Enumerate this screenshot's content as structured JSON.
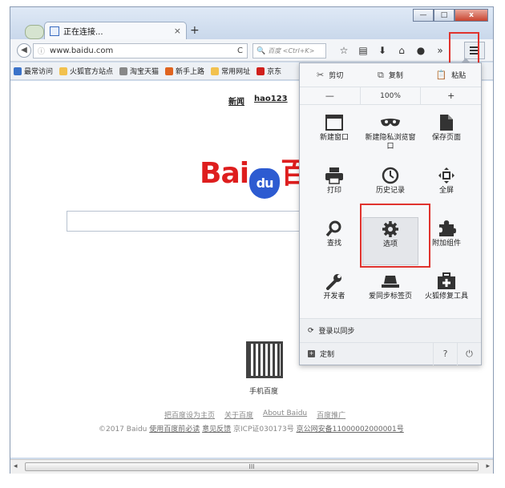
{
  "tab": {
    "title": "正在连接...",
    "close": "×",
    "new_tab": "+"
  },
  "window": {
    "minimize": "—",
    "maximize": "□",
    "close": "x"
  },
  "navbar": {
    "url": "www.baidu.com",
    "search_placeholder": "百度 <Ctrl+K>",
    "icons": [
      "star-icon",
      "library-icon",
      "download-icon",
      "home-icon",
      "chat-icon",
      "overflow-icon"
    ]
  },
  "bookmarks": [
    {
      "label": "最常访问",
      "color": "#3b73c9"
    },
    {
      "label": "火狐官方站点",
      "color": "#f2c14e"
    },
    {
      "label": "淘宝天猫",
      "color": "#888888"
    },
    {
      "label": "新手上路",
      "color": "#e0641f"
    },
    {
      "label": "常用网址",
      "color": "#f2c14e"
    },
    {
      "label": "京东",
      "color": "#d0201c"
    }
  ],
  "content": {
    "top_links": [
      "新闻",
      "hao123"
    ],
    "logo_left": "Bai",
    "logo_paw": "du",
    "logo_right": "百",
    "qr_label": "手机百度",
    "footer_links": [
      "把百度设为主页",
      "关于百度",
      "About Baidu",
      "百度推广"
    ],
    "footer_copy_prefix": "©2017 Baidu ",
    "footer_copy_links": [
      "使用百度前必读",
      "意见反馈"
    ],
    "footer_icp": " 京ICP证030173号 ",
    "footer_police": "京公网安备11000002000001号"
  },
  "menu": {
    "edit": {
      "cut": "剪切",
      "copy": "复制",
      "paste": "粘贴"
    },
    "zoom": {
      "minus": "—",
      "value": "100%",
      "plus": "+"
    },
    "items": [
      {
        "label": "新建窗口",
        "icon": "window-icon"
      },
      {
        "label": "新建隐私浏览窗口",
        "icon": "mask-icon"
      },
      {
        "label": "保存页面",
        "icon": "page-icon"
      },
      {
        "label": "打印",
        "icon": "printer-icon"
      },
      {
        "label": "历史记录",
        "icon": "clock-icon"
      },
      {
        "label": "全屏",
        "icon": "fullscreen-icon"
      },
      {
        "label": "查找",
        "icon": "search-icon"
      },
      {
        "label": "选项",
        "icon": "gear-icon"
      },
      {
        "label": "附加组件",
        "icon": "puzzle-icon"
      },
      {
        "label": "开发者",
        "icon": "wrench-icon"
      },
      {
        "label": "爱同步标签页",
        "icon": "sync-tabs-icon"
      },
      {
        "label": "火狐修复工具",
        "icon": "repair-kit-icon"
      }
    ],
    "sync": "登录以同步",
    "customize": "定制",
    "help": "?",
    "quit": "⏻"
  },
  "scrollbar": {
    "thumb_grip": "III"
  }
}
